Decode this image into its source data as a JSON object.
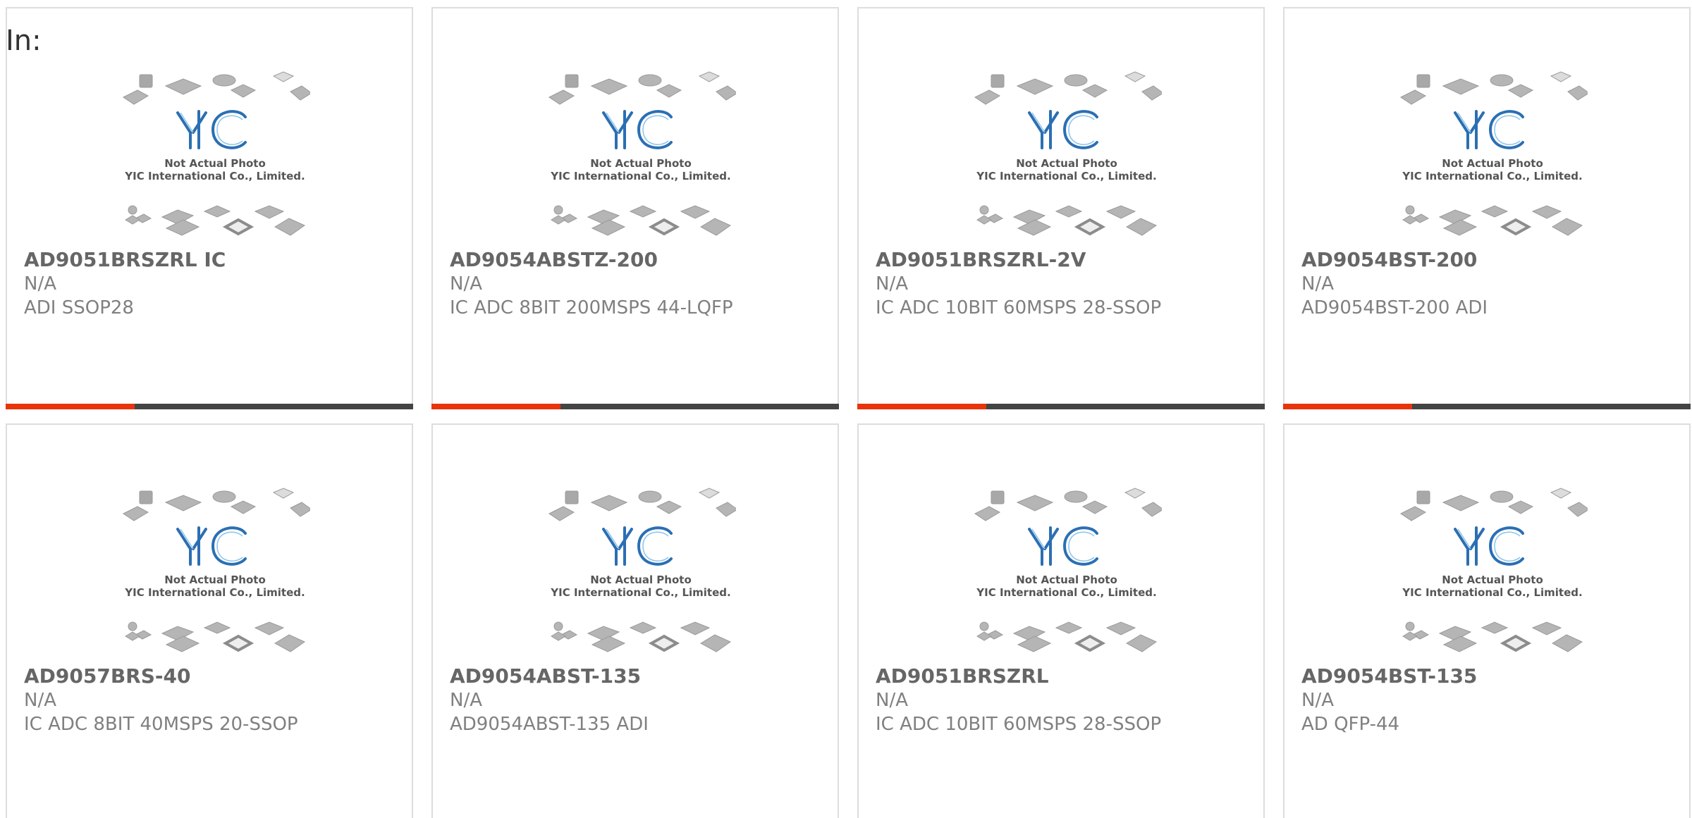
{
  "header": {
    "label": "In:"
  },
  "colors": {
    "accent": "#e8340c",
    "bar_dark": "#444444"
  },
  "image": {
    "logo_text": "YIC",
    "caption_line1": "Not Actual Photo",
    "caption_line2": "YIC International Co., Limited."
  },
  "products": [
    {
      "name": "AD9051BRSZRL IC",
      "stock": "N/A",
      "description": "ADI SSOP28"
    },
    {
      "name": "AD9054ABSTZ-200",
      "stock": "N/A",
      "description": "IC ADC 8BIT 200MSPS 44-LQFP"
    },
    {
      "name": "AD9051BRSZRL-2V",
      "stock": "N/A",
      "description": "IC ADC 10BIT 60MSPS 28-SSOP"
    },
    {
      "name": "AD9054BST-200",
      "stock": "N/A",
      "description": "AD9054BST-200 ADI"
    },
    {
      "name": "AD9057BRS-40",
      "stock": "N/A",
      "description": "IC ADC 8BIT 40MSPS 20-SSOP"
    },
    {
      "name": "AD9054ABST-135",
      "stock": "N/A",
      "description": "AD9054ABST-135 ADI"
    },
    {
      "name": "AD9051BRSZRL",
      "stock": "N/A",
      "description": "IC ADC 10BIT 60MSPS 28-SSOP"
    },
    {
      "name": "AD9054BST-135",
      "stock": "N/A",
      "description": "AD QFP-44"
    }
  ]
}
